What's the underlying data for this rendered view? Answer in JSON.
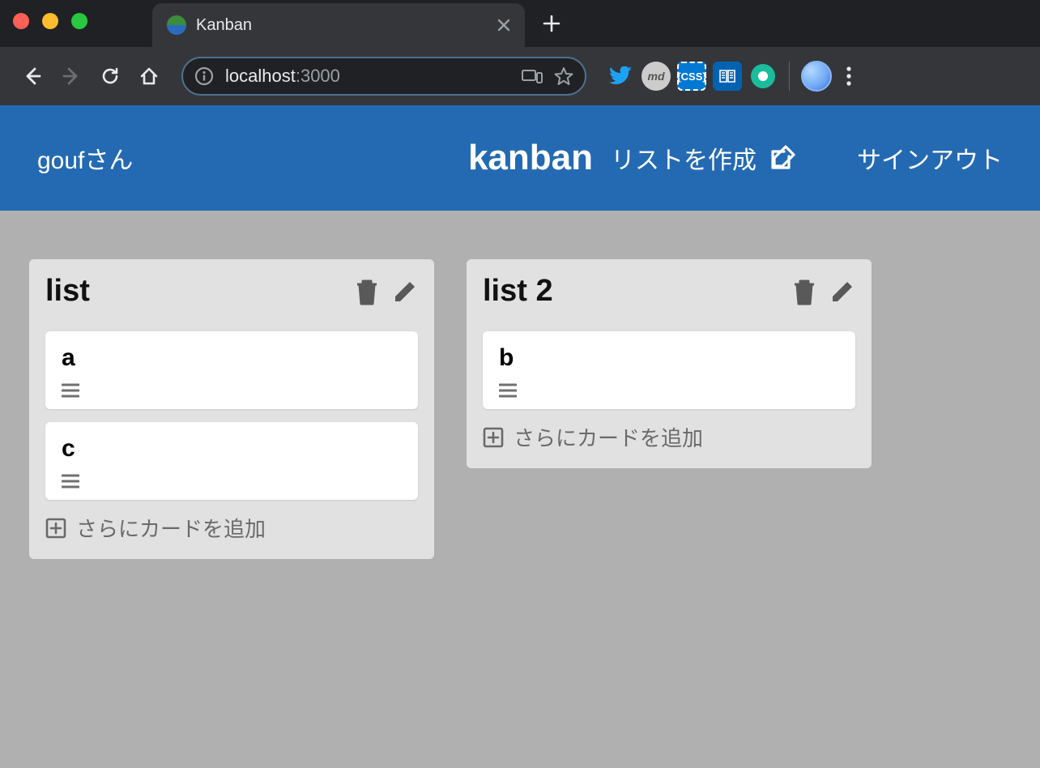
{
  "browser": {
    "tab_title": "Kanban",
    "url_host": "localhost",
    "url_port": ":3000"
  },
  "header": {
    "user_label": "goufさん",
    "brand": "kanban",
    "create_list_label": "リストを作成",
    "signout_label": "サインアウト"
  },
  "lists": [
    {
      "title": "list",
      "cards": [
        {
          "title": "a"
        },
        {
          "title": "c"
        }
      ],
      "add_card_label": "さらにカードを追加"
    },
    {
      "title": "list 2",
      "cards": [
        {
          "title": "b"
        }
      ],
      "add_card_label": "さらにカードを追加"
    }
  ]
}
